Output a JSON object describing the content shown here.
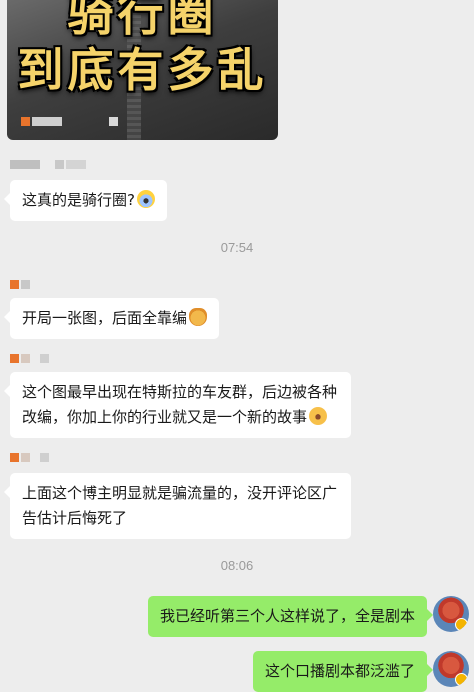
{
  "video_card": {
    "title_line1": "骑行圈",
    "title_line2": "到底有多乱"
  },
  "messages": [
    {
      "side": "left",
      "text": "这真的是骑行圈?",
      "emoji": "scream-face-icon"
    },
    {
      "side": "time",
      "text": "07:54"
    },
    {
      "side": "left",
      "text": "开局一张图，后面全靠编",
      "emoji": "cat-face-icon"
    },
    {
      "side": "left",
      "text": "这个图最早出现在特斯拉的车友群，后边被各种改编，你加上你的行业就又是一个新的故事",
      "emoji": "hot-face-icon"
    },
    {
      "side": "left",
      "text": "上面这个博主明显就是骗流量的，没开评论区广告估计后悔死了"
    },
    {
      "side": "time",
      "text": "08:06"
    },
    {
      "side": "right",
      "text": "我已经听第三个人这样说了，全是剧本"
    },
    {
      "side": "right",
      "text": "这个口播剧本都泛滥了"
    }
  ],
  "colors": {
    "background": "#ededed",
    "left_bubble": "#ffffff",
    "right_bubble": "#95ec69",
    "timestamp": "#9a9a9a",
    "title_text": "#f5d36a"
  }
}
